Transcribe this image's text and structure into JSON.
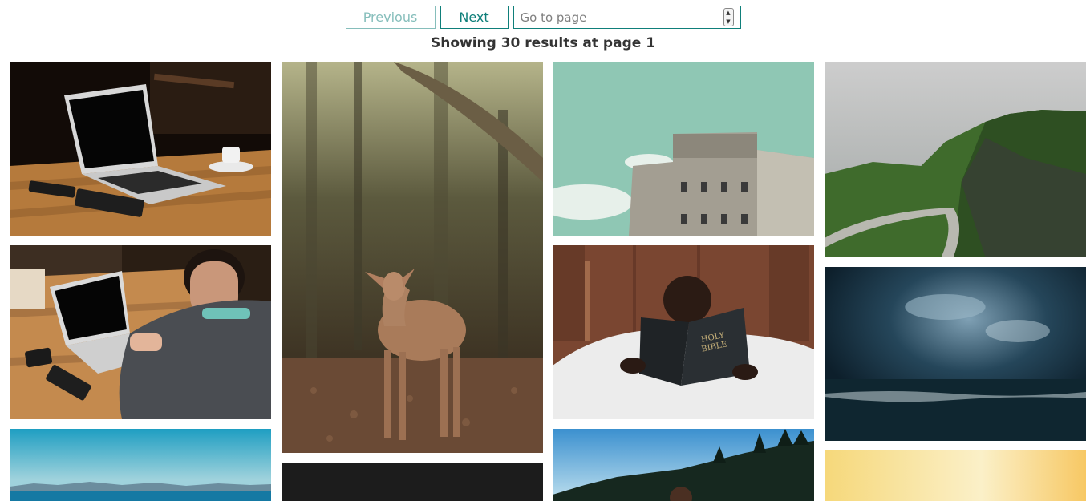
{
  "pagination": {
    "previous_label": "Previous",
    "next_label": "Next",
    "goto_placeholder": "Go to page"
  },
  "results": {
    "summary": "Showing 30 results at page 1"
  },
  "photos": [
    {
      "subject": "laptop on wooden table with coffee cup"
    },
    {
      "subject": "person typing on laptop at wooden desk"
    },
    {
      "subject": "blue sea horizon and sky"
    },
    {
      "subject": "young deer in autumn forest"
    },
    {
      "subject": "dark image"
    },
    {
      "subject": "concrete bunker under teal sky"
    },
    {
      "subject": "child reading holy bible on bed"
    },
    {
      "subject": "pine forest under blue sky"
    },
    {
      "subject": "green cliffs and winding road"
    },
    {
      "subject": "dark stormy clouds over sea"
    },
    {
      "subject": "warm yellow haze"
    }
  ]
}
